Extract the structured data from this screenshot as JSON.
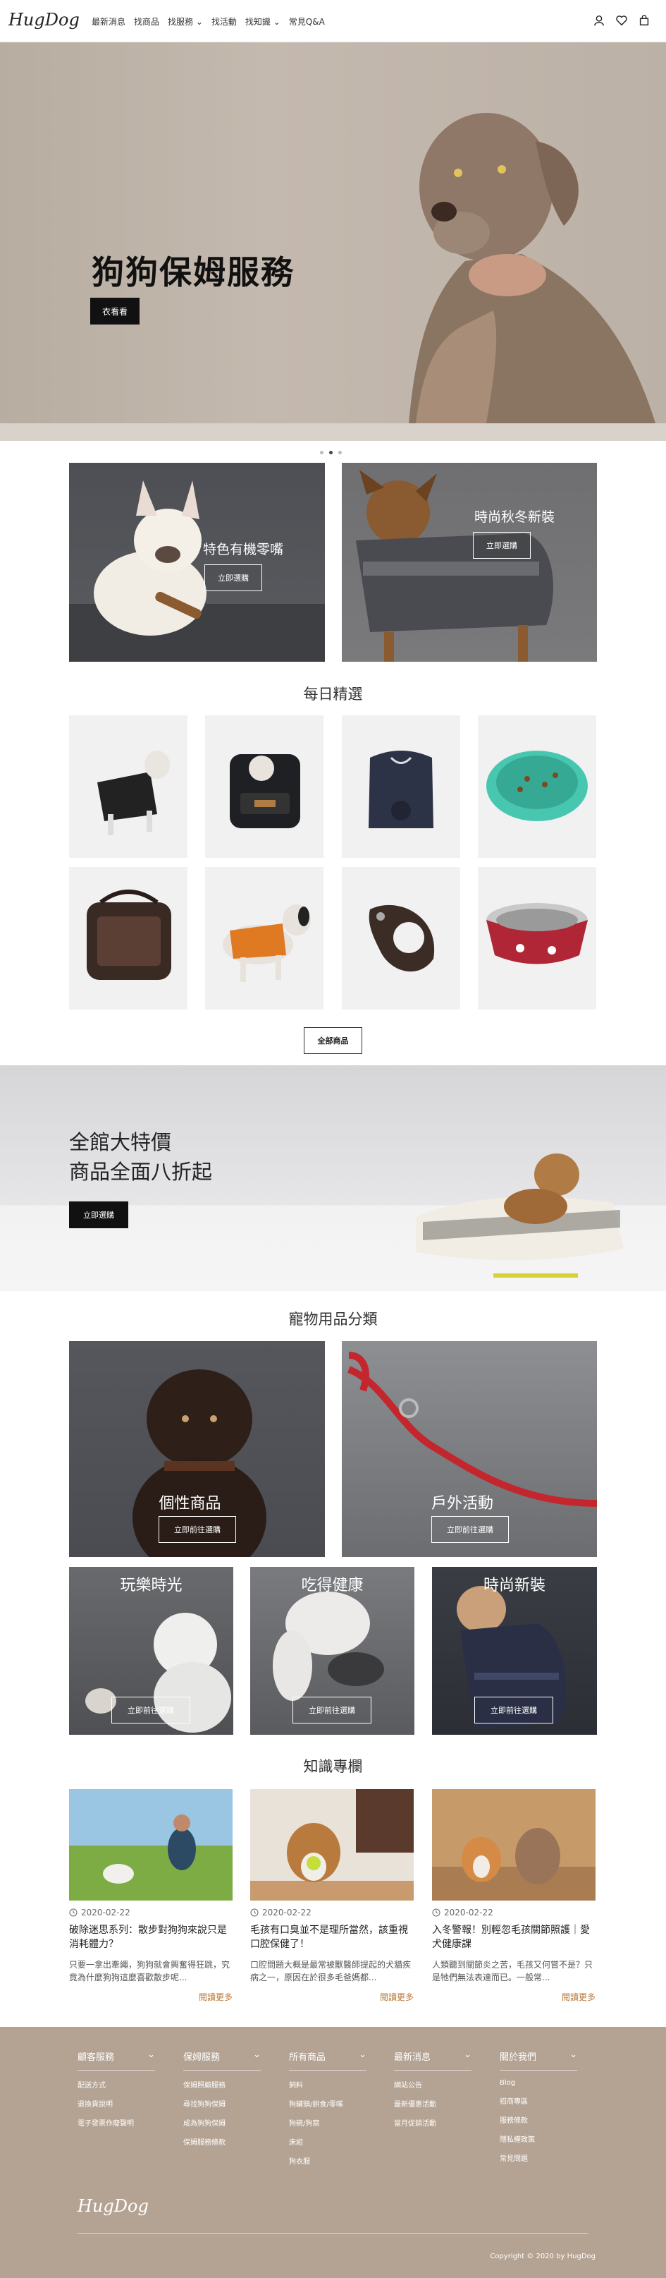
{
  "header": {
    "logo": "HugDog",
    "nav": [
      "最新消息",
      "找商品",
      "找服務 ⌄",
      "找活動",
      "找知識 ⌄",
      "常見Q&A"
    ]
  },
  "hero": {
    "title": "狗狗保姆服務",
    "button": "衣看看"
  },
  "promos": [
    {
      "title": "特色有機零嘴",
      "button": "立即選購"
    },
    {
      "title": "時尚秋冬新裝",
      "button": "立即選購"
    }
  ],
  "daily": {
    "heading": "每日精選",
    "more_button": "全部商品"
  },
  "sale": {
    "line1": "全館大特價",
    "line2": "商品全面八折起",
    "button": "立即選購"
  },
  "categories": {
    "heading": "寵物用品分類",
    "items": [
      {
        "label": "個性商品",
        "button": "立即前往選購"
      },
      {
        "label": "戶外活動",
        "button": "立即前往選購"
      },
      {
        "label": "玩樂時光",
        "button": "立即前往選購"
      },
      {
        "label": "吃得健康",
        "button": "立即前往選購"
      },
      {
        "label": "時尚新裝",
        "button": "立即前往選購"
      }
    ]
  },
  "knowledge": {
    "heading": "知識專欄",
    "posts": [
      {
        "date": "2020-02-22",
        "title": "破除迷思系列：散步對狗狗來說只是消耗體力？",
        "excerpt": "只要一拿出牽繩，狗狗就會興奮得狂跳，究竟為什麼狗狗這麼喜歡散步呢...",
        "more": "閱讀更多"
      },
      {
        "date": "2020-02-22",
        "title": "毛孩有口臭並不是理所當然，該重視口腔保健了！",
        "excerpt": "口腔問題大概是最常被獸醫師提起的犬貓疾病之一，原因在於很多毛爸媽都...",
        "more": "閱讀更多"
      },
      {
        "date": "2020-02-22",
        "title": "入冬警報！別輕忽毛孩關節照護｜愛犬健康課",
        "excerpt": "人類聽到關節炎之苦，毛孩又何嘗不是？只是牠們無法表達而已。一般常...",
        "more": "閱讀更多"
      }
    ]
  },
  "footer": {
    "columns": [
      {
        "heading": "顧客服務",
        "items": [
          "配送方式",
          "退換貨說明",
          "電子發票作廢聲明"
        ]
      },
      {
        "heading": "保姆服務",
        "items": [
          "保姆照顧服務",
          "尋找狗狗保姆",
          "成為狗狗保姆",
          "保姆服務條款"
        ]
      },
      {
        "heading": "所有商品",
        "items": [
          "飼料",
          "狗罐頭/餅食/零嘴",
          "狗碗/狗窩",
          "床組",
          "狗衣服"
        ]
      },
      {
        "heading": "最新消息",
        "items": [
          "網站公告",
          "最新優惠活動",
          "當月促銷活動"
        ]
      },
      {
        "heading": "關於我們",
        "items": [
          "Blog",
          "招商專區",
          "服務條款",
          "隱私權政策",
          "常見問題"
        ]
      }
    ],
    "logo": "HugDog",
    "copyright": "Copyright © 2020 by HugDog"
  },
  "colors": {
    "footer_bg": "#b4a393",
    "accent_more": "#b8773a",
    "hero_bg": "#bcb1a6"
  }
}
